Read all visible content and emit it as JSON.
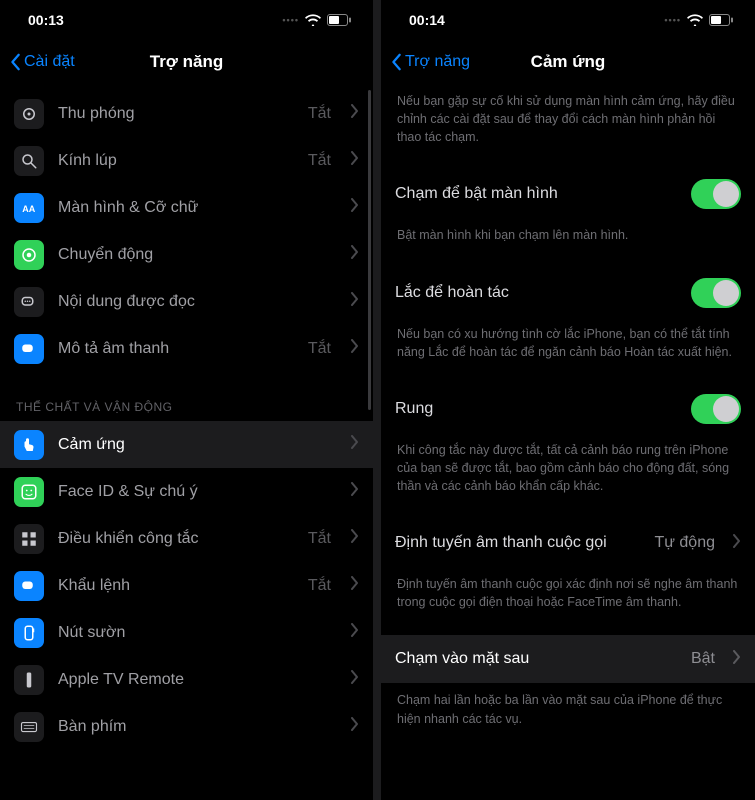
{
  "left": {
    "status_time": "00:13",
    "nav_back": "Cài đặt",
    "nav_title": "Trợ năng",
    "off_label": "Tắt",
    "section_header": "THỂ CHẤT VÀ VẬN ĐỘNG",
    "rows_top": [
      {
        "label": "Thu phóng",
        "value": "Tắt",
        "icon": "zoom",
        "color": "#1c1c1e"
      },
      {
        "label": "Kính lúp",
        "value": "Tắt",
        "icon": "magnifier",
        "color": "#1c1c1e"
      },
      {
        "label": "Màn hình & Cỡ chữ",
        "value": "",
        "icon": "aa",
        "color": "#0a84ff"
      },
      {
        "label": "Chuyển động",
        "value": "",
        "icon": "motion",
        "color": "#30d158"
      },
      {
        "label": "Nội dung được đọc",
        "value": "",
        "icon": "speech",
        "color": "#1c1c1e"
      },
      {
        "label": "Mô tả âm thanh",
        "value": "Tắt",
        "icon": "audiodesc",
        "color": "#0a84ff"
      }
    ],
    "rows_bottom": [
      {
        "label": "Cảm ứng",
        "value": "",
        "icon": "touch",
        "color": "#0a84ff",
        "selected": true
      },
      {
        "label": "Face ID & Sự chú ý",
        "value": "",
        "icon": "face",
        "color": "#30d158"
      },
      {
        "label": "Điều khiển công tắc",
        "value": "Tắt",
        "icon": "switch",
        "color": "#1c1c1e"
      },
      {
        "label": "Khẩu lệnh",
        "value": "Tắt",
        "icon": "voice",
        "color": "#0a84ff"
      },
      {
        "label": "Nút sườn",
        "value": "",
        "icon": "sidebtn",
        "color": "#0a84ff"
      },
      {
        "label": "Apple TV Remote",
        "value": "",
        "icon": "remote",
        "color": "#1c1c1e"
      },
      {
        "label": "Bàn phím",
        "value": "",
        "icon": "keyboard",
        "color": "#1c1c1e"
      }
    ]
  },
  "right": {
    "status_time": "00:14",
    "nav_back": "Trợ năng",
    "nav_title": "Cảm ứng",
    "intro_desc": "Nếu bạn gặp sự cố khi sử dụng màn hình cảm ứng, hãy điều chỉnh các cài đặt sau để thay đổi cách màn hình phản hồi thao tác chạm.",
    "items": {
      "tap_wake_label": "Chạm để bật màn hình",
      "tap_wake_on": true,
      "tap_wake_desc": "Bật màn hình khi bạn chạm lên màn hình.",
      "shake_label": "Lắc để hoàn tác",
      "shake_on": true,
      "shake_desc": "Nếu bạn có xu hướng tình cờ lắc iPhone, bạn có thể tắt tính năng Lắc để hoàn tác để ngăn cảnh báo Hoàn tác xuất hiện.",
      "vibrate_label": "Rung",
      "vibrate_on": true,
      "vibrate_desc": "Khi công tắc này được tắt, tất cả cảnh báo rung trên iPhone của bạn sẽ được tắt, bao gồm cảnh báo cho động đất, sóng thần và các cảnh báo khẩn cấp khác.",
      "route_label": "Định tuyến âm thanh cuộc gọi",
      "route_value": "Tự động",
      "route_desc": "Định tuyến âm thanh cuộc gọi xác định nơi sẽ nghe âm thanh trong cuộc gọi điện thoại hoặc FaceTime âm thanh.",
      "backtap_label": "Chạm vào mặt sau",
      "backtap_value": "Bật",
      "backtap_desc": "Chạm hai lần hoặc ba lần vào mặt sau của iPhone để thực hiện nhanh các tác vụ."
    }
  }
}
